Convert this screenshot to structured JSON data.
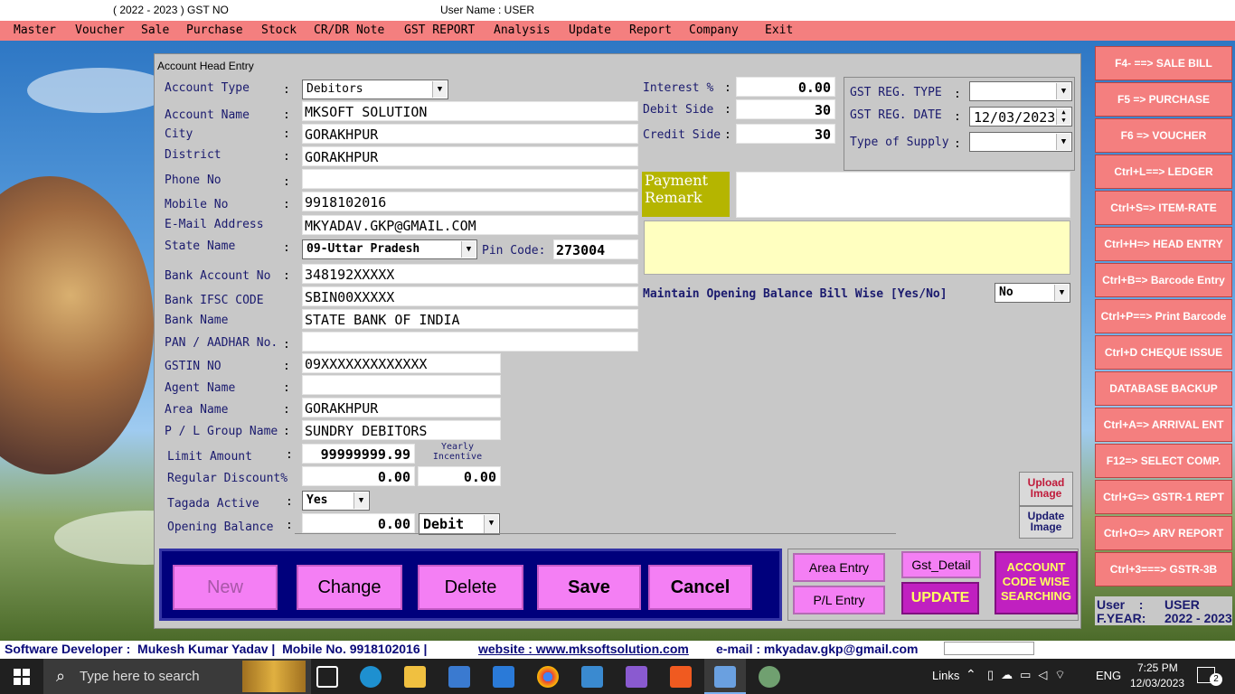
{
  "topbar": {
    "year_info": "( 2022 - 2023 )  GST NO",
    "user_info": "User Name : USER"
  },
  "menu": [
    "Master",
    "Voucher",
    "Sale",
    "Purchase",
    "Stock",
    "CR/DR Note",
    "GST REPORT",
    "Analysis",
    "Update",
    "Report",
    "Company",
    "Exit"
  ],
  "window_title": "Account Head Entry",
  "labels": {
    "account_type": "Account Type",
    "account_name": "Account Name",
    "city": "City",
    "district": "District",
    "phone": "Phone No",
    "mobile": "Mobile No",
    "email": "E-Mail  Address",
    "state": "State Name",
    "pin": "Pin Code:",
    "bank_acc": "Bank Account No",
    "ifsc": "Bank IFSC CODE",
    "bank_name": "Bank Name",
    "pan": "PAN / AADHAR No.",
    "gstin": "GSTIN NO",
    "agent": "Agent Name",
    "area": "Area Name",
    "pl_group": "P / L Group Name",
    "limit": "Limit Amount",
    "regular_discount": "Regular Discount%",
    "tagada": "Tagada Active",
    "opening": "Opening Balance",
    "yearly_incentive": "Yearly Incentive",
    "interest": "Interest %",
    "debit_side": "Debit Side",
    "credit_side": "Credit Side",
    "gst_reg_type": "GST REG. TYPE",
    "gst_reg_date": "GST REG. DATE",
    "type_supply": "Type of Supply",
    "payment_remark": "Payment Remark",
    "maintain_opening": "Maintain Opening Balance Bill Wise [Yes/No]"
  },
  "values": {
    "account_type": "Debitors",
    "account_name": "MKSOFT SOLUTION",
    "city": "GORAKHPUR",
    "district": "GORAKHPUR",
    "phone": "",
    "mobile": "9918102016",
    "email": "MKYADAV.GKP@GMAIL.COM",
    "state": "09-Uttar Pradesh",
    "pin": "273004",
    "bank_acc": "348192XXXXX",
    "ifsc": "SBIN00XXXXX",
    "bank_name": "STATE BANK OF INDIA",
    "pan": "",
    "gstin": "09XXXXXXXXXXXXX",
    "agent": "",
    "area": "GORAKHPUR",
    "pl_group": "SUNDRY DEBITORS",
    "limit": "99999999.99",
    "regular_discount": "0.00",
    "yearly_incentive": "0.00",
    "tagada": "Yes",
    "opening": "0.00",
    "opening_type": "Debit",
    "interest": "0.00",
    "debit_side": "30",
    "credit_side": "30",
    "gst_reg_type": "",
    "gst_reg_date": "12/03/2023",
    "type_supply": "",
    "payment_remark": "",
    "maintain_opening": "No"
  },
  "buttons": {
    "new": "New",
    "change": "Change",
    "delete": "Delete",
    "save": "Save",
    "cancel": "Cancel",
    "area_entry": "Area Entry",
    "pl_entry": "P/L Entry",
    "gst_detail": "Gst_Detail",
    "update": "UPDATE",
    "account_search": "ACCOUNT CODE WISE SEARCHING",
    "upload_image": "Upload Image",
    "update_image": "Update Image"
  },
  "sidebar": [
    "F4- ==> SALE BILL",
    "F5 => PURCHASE",
    "F6 => VOUCHER",
    "Ctrl+L==> LEDGER",
    "Ctrl+S=> ITEM-RATE",
    "Ctrl+H=> HEAD ENTRY",
    "Ctrl+B=> Barcode Entry",
    "Ctrl+P==> Print Barcode",
    "Ctrl+D CHEQUE ISSUE",
    "DATABASE BACKUP",
    "Ctrl+A=> ARRIVAL ENT",
    "F12=> SELECT COMP.",
    "Ctrl+G=> GSTR-1 REPT",
    "Ctrl+O=> ARV REPORT",
    "Ctrl+3===> GSTR-3B"
  ],
  "user_box": {
    "user_label": "User    :",
    "user_value": "USER",
    "year_label": "F.YEAR:",
    "year_value": "2022 - 2023"
  },
  "footer": {
    "developer": "Software Developer :  Mukesh Kumar Yadav |  Mobile No. 9918102016 | ",
    "website": "website : www.mksoftsolution.com",
    "email": "e-mail : mkyadav.gkp@gmail.com"
  },
  "taskbar": {
    "search_placeholder": "Type here to search",
    "links": "Links",
    "lang": "ENG",
    "time": "7:25 PM",
    "date": "12/03/2023",
    "notif_count": "2"
  },
  "colors": {
    "menubar": "#f47f7f",
    "button_magenta": "#f47ff4",
    "navy_panel": "#00007c",
    "remark_bg": "#b5b500",
    "remark_area": "#ffffc0"
  }
}
